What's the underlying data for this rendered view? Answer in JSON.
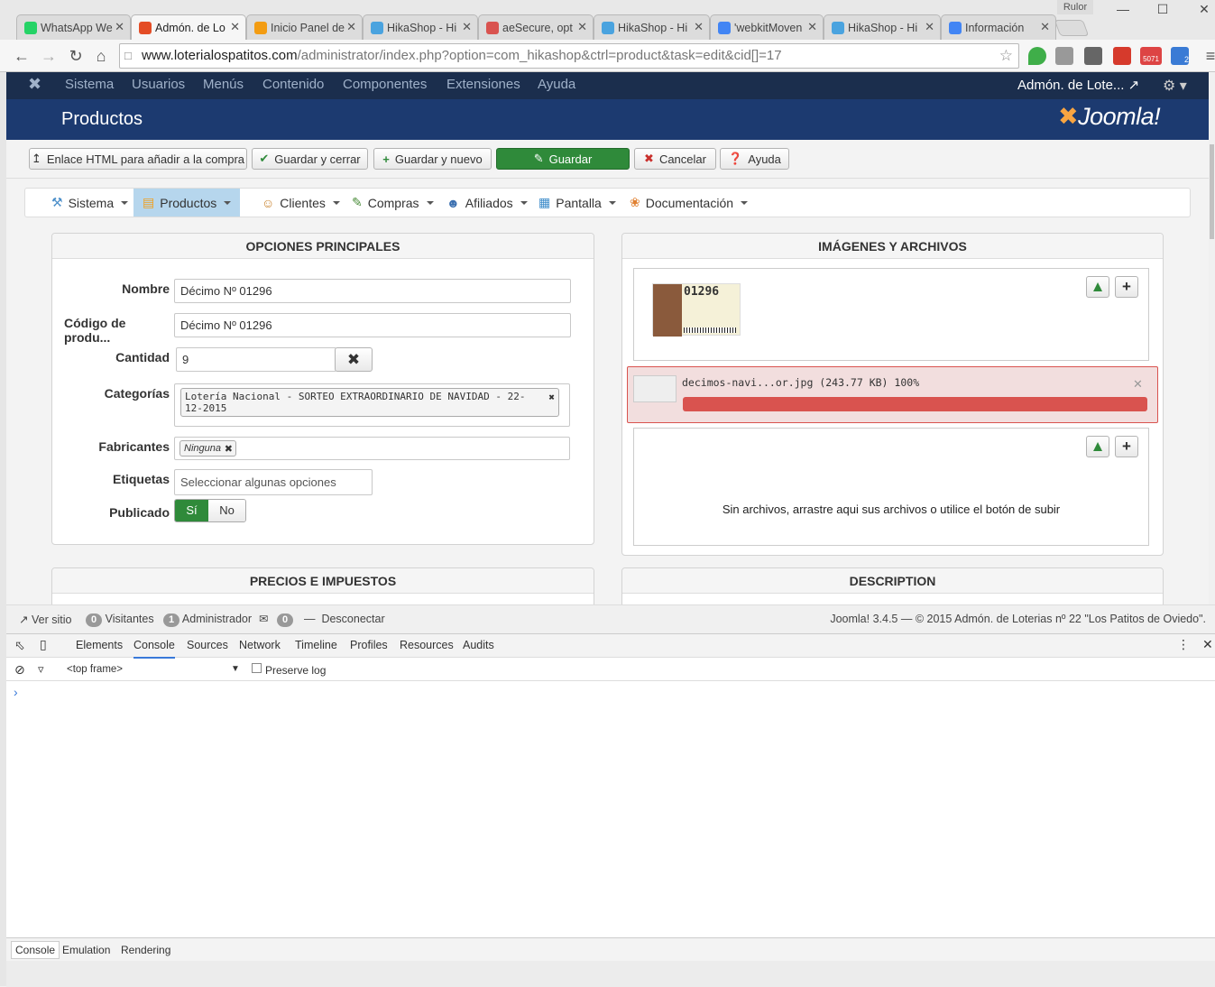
{
  "browser": {
    "profile": "Rulor",
    "tabs": [
      {
        "title": "WhatsApp We",
        "color": "#25d366"
      },
      {
        "title": "Admón. de Lo",
        "color": "#e44d26",
        "active": true
      },
      {
        "title": "Inicio Panel de",
        "color": "#f39c12"
      },
      {
        "title": "HikaShop - Hi",
        "color": "#4aa3df"
      },
      {
        "title": "aeSecure, opt",
        "color": "#d9534f"
      },
      {
        "title": "HikaShop - Hi",
        "color": "#4aa3df"
      },
      {
        "title": "'webkitMoven",
        "color": "#4285f4"
      },
      {
        "title": "HikaShop - Hi",
        "color": "#4aa3df"
      },
      {
        "title": "Información",
        "color": "#4285f4"
      }
    ],
    "url_host": "www.loterialospatitos.com",
    "url_path": "/administrator/index.php?option=com_hikashop&ctrl=product&task=edit&cid[]=17",
    "gmail_count": "5071",
    "ext_badge": "2"
  },
  "joomla": {
    "menu": [
      "Sistema",
      "Usuarios",
      "Menús",
      "Contenido",
      "Componentes",
      "Extensiones",
      "Ayuda"
    ],
    "user": "Admón. de Lote...",
    "page_title": "Productos",
    "logo": "Joomla!",
    "toolbar": {
      "html_link": "Enlace HTML para añadir a la compra",
      "save_close": "Guardar y cerrar",
      "save_new": "Guardar y nuevo",
      "save": "Guardar",
      "cancel": "Cancelar",
      "help": "Ayuda"
    }
  },
  "hikamenu": [
    {
      "label": "Sistema",
      "icon": "tools-icon"
    },
    {
      "label": "Productos",
      "icon": "products-icon",
      "active": true
    },
    {
      "label": "Clientes",
      "icon": "customers-icon"
    },
    {
      "label": "Compras",
      "icon": "orders-icon"
    },
    {
      "label": "Afiliados",
      "icon": "affiliates-icon"
    },
    {
      "label": "Pantalla",
      "icon": "display-icon"
    },
    {
      "label": "Documentación",
      "icon": "docs-icon"
    }
  ],
  "main_options": {
    "header": "OPCIONES PRINCIPALES",
    "name_label": "Nombre",
    "name_value": "Décimo Nº 01296",
    "code_label": "Código de produ...",
    "code_value": "Décimo Nº 01296",
    "qty_label": "Cantidad",
    "qty_value": "9",
    "cat_label": "Categorías",
    "cat_value": "Lotería Nacional - SORTEO EXTRAORDINARIO DE NAVIDAD - 22-12-2015",
    "mfr_label": "Fabricantes",
    "mfr_value": "Ninguna",
    "tags_label": "Etiquetas",
    "tags_placeholder": "Seleccionar algunas opciones",
    "pub_label": "Publicado",
    "pub_yes": "Sí",
    "pub_no": "No"
  },
  "images": {
    "header": "IMÁGENES Y ARCHIVOS",
    "thumb_number": "01296",
    "upload_name": "decimos-navi...or.jpg (243.77 KB)",
    "upload_progress": "100%",
    "progress_fraction": 1.0,
    "empty_text": "Sin archivos, arrastre aqui sus archivos o utilice el botón de subir"
  },
  "prices": {
    "header": "PRECIOS E IMPUESTOS"
  },
  "description": {
    "header": "DESCRIPTION"
  },
  "status": {
    "view_site": "Ver sitio",
    "visitors_count": "0",
    "visitors": "Visitantes",
    "admin_count": "1",
    "admin": "Administrador",
    "msg_count": "0",
    "logout": "Desconectar",
    "footer": "Joomla! 3.4.5  —  © 2015 Admón. de Loterias nº 22 \"Los Patitos de Oviedo\"."
  },
  "devtools": {
    "tabs": [
      "Elements",
      "Console",
      "Sources",
      "Network",
      "Timeline",
      "Profiles",
      "Resources",
      "Audits"
    ],
    "frame": "<top frame>",
    "preserve_log": "Preserve log",
    "prompt": "›",
    "drawer_tabs": [
      "Console",
      "Emulation",
      "Rendering"
    ]
  }
}
